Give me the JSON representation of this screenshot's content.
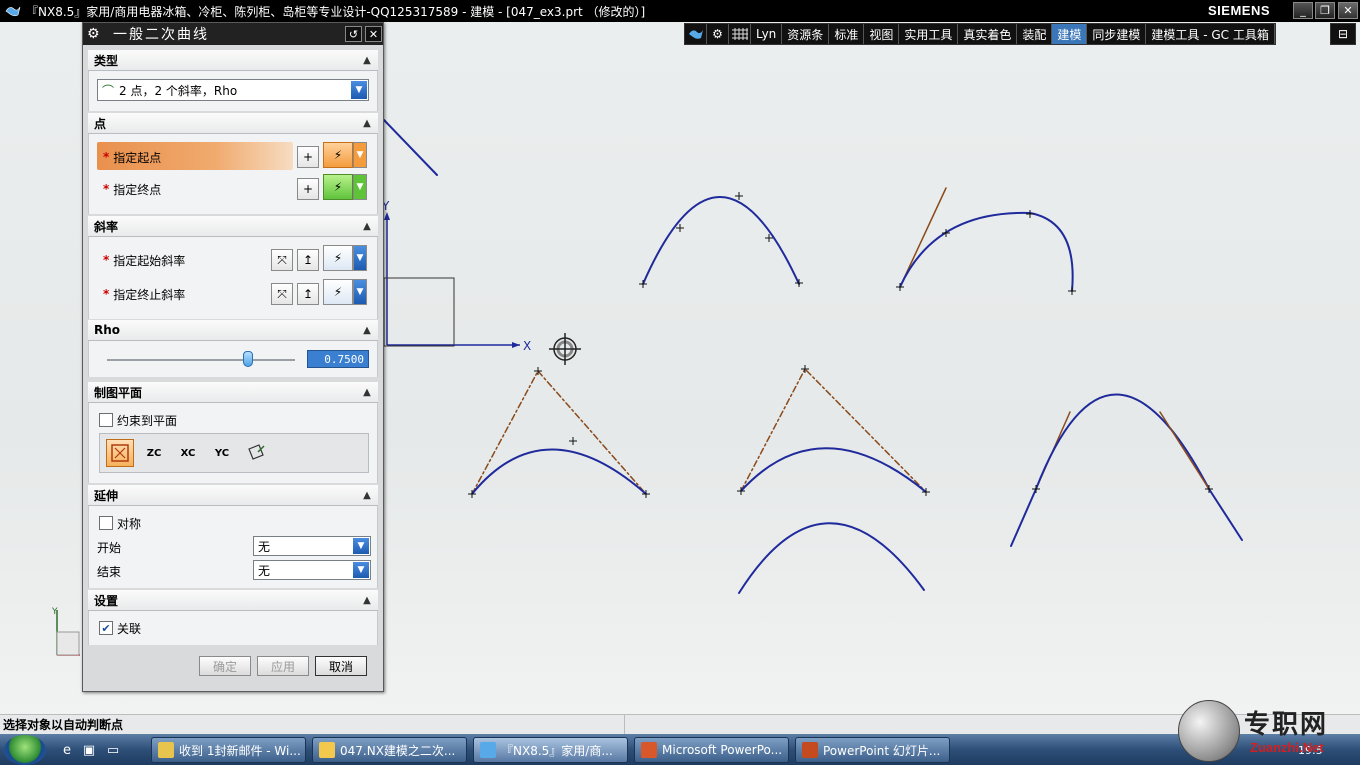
{
  "window": {
    "title": "『NX8.5』家用/商用电器冰箱、冷柜、陈列柜、岛柜等专业设计-QQ125317589 - 建模 - [047_ex3.prt （修改的）]",
    "brand": "SIEMENS",
    "controls": [
      "_",
      "❐",
      "✕"
    ]
  },
  "ribbon": {
    "tabs": [
      "Lyn",
      "资源条",
      "标准",
      "视图",
      "实用工具",
      "真实着色",
      "装配",
      "建模",
      "同步建模",
      "建模工具 - GC 工具箱"
    ],
    "active_tab": "建模"
  },
  "dialog": {
    "title": "一般二次曲线",
    "sections": {
      "type": {
        "header": "类型",
        "value": "2 点，2 个斜率，Rho"
      },
      "points": {
        "header": "点",
        "start_label": "指定起点",
        "end_label": "指定终点"
      },
      "slopes": {
        "header": "斜率",
        "start_label": "指定起始斜率",
        "end_label": "指定终止斜率"
      },
      "rho": {
        "header": "Rho",
        "value": "0.7500",
        "slider_fraction": 0.75
      },
      "plane": {
        "header": "制图平面",
        "constrain_label": "约束到平面",
        "constrain_checked": false,
        "buttons": [
          "ZC",
          "XC",
          "YC"
        ]
      },
      "extend": {
        "header": "延伸",
        "symmetric_label": "对称",
        "symmetric_checked": false,
        "start_label": "开始",
        "start_value": "无",
        "end_label": "结束",
        "end_value": "无"
      },
      "settings": {
        "header": "设置",
        "associative_label": "关联",
        "associative_checked": true
      }
    },
    "buttons": {
      "ok": "确定",
      "apply": "应用",
      "cancel": "取消"
    }
  },
  "viewport": {
    "axis_x": "X",
    "axis_y": "Y",
    "curve_color": "#1f2a9c",
    "tangent_color": "#8a4a1a"
  },
  "status": {
    "message": "选择对象以自动判断点"
  },
  "taskbar": {
    "tasks": [
      "收到 1封新邮件 - Wi...",
      "047.NX建模之二次...",
      "『NX8.5』家用/商...",
      "Microsoft PowerPo...",
      "PowerPoint 幻灯片..."
    ],
    "active_task": 2,
    "clock": "19:5"
  },
  "watermark": {
    "text": "专职网",
    "url": "Zuanzhi.Net"
  }
}
